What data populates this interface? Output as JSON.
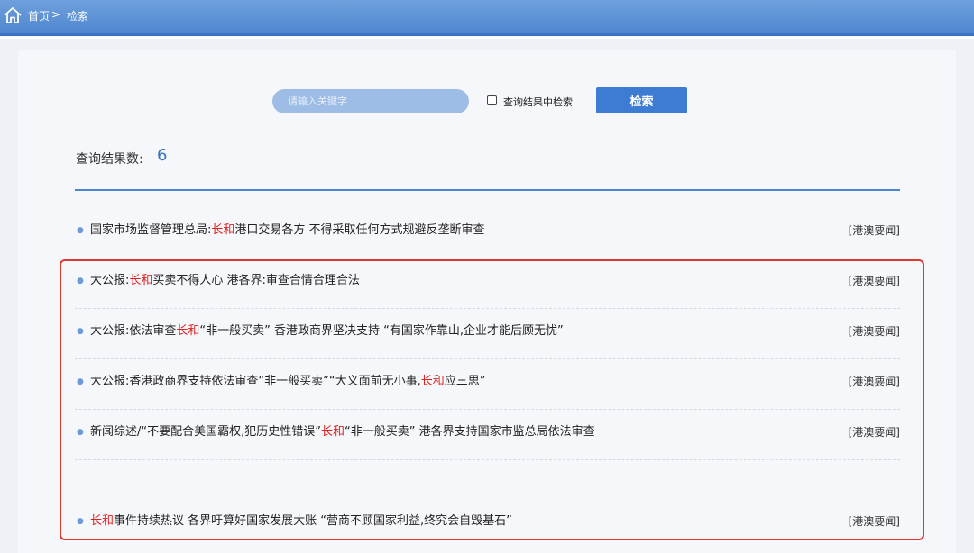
{
  "breadcrumb": {
    "home": "首页",
    "separator": ">",
    "current": "检索"
  },
  "search": {
    "placeholder": "请输入关键字",
    "within_results_label": "查询结果中检索",
    "within_results_checked": false,
    "button_label": "检索"
  },
  "results_summary": {
    "label": "查询结果数:",
    "count": "6"
  },
  "results": [
    {
      "parts": [
        "国家市场监督管理总局:",
        "长和",
        "港口交易各方 不得采取任何方式规避反垄断审查"
      ],
      "category": "[港澳要闻]"
    },
    {
      "parts": [
        "大公报:",
        "长和",
        "买卖不得人心 港各界:审查合情合理合法"
      ],
      "category": "[港澳要闻]"
    },
    {
      "parts": [
        "大公报:依法审查",
        "长和",
        "“非一般买卖” 香港政商界坚决支持 “有国家作靠山,企业才能后顾无忧”"
      ],
      "category": "[港澳要闻]"
    },
    {
      "parts": [
        "大公报:香港政商界支持依法审查“非一般买卖”“大义面前无小事,",
        "长和",
        "应三思”"
      ],
      "category": "[港澳要闻]"
    },
    {
      "parts": [
        "新闻综述/“不要配合美国霸权,犯历史性错误”",
        "长和",
        "“非一般买卖”  港各界支持国家市监总局依法审查"
      ],
      "category": "[港澳要闻]"
    },
    {
      "parts": [
        "",
        "长和",
        "事件持续热议 各界吁算好国家发展大账 “营商不顾国家利益,终究会自毁基石”"
      ],
      "category": "[港澳要闻]"
    }
  ],
  "colors": {
    "header": "#4e86cf",
    "accent": "#3b73c2",
    "keyword_highlight": "#e0201c",
    "annotation_box": "#e0362e"
  }
}
